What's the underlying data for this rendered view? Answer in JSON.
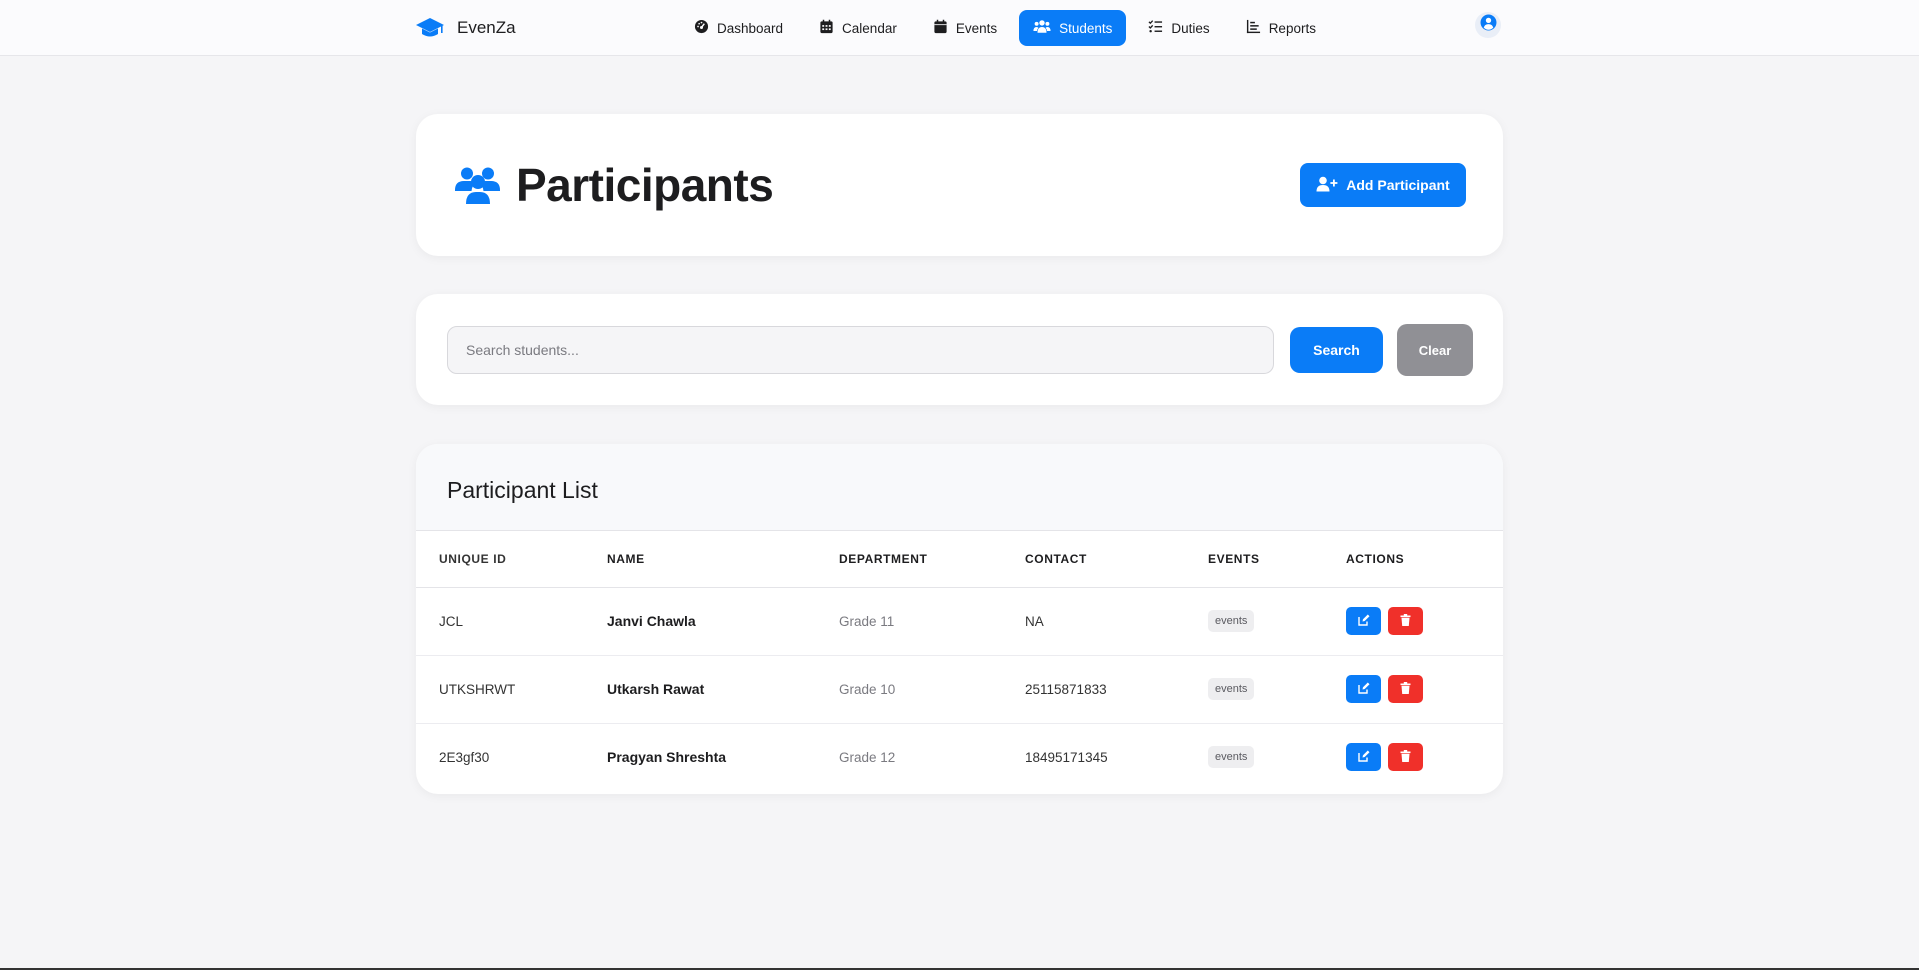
{
  "brand": {
    "name": "EvenZa",
    "icon": "graduation-cap-icon"
  },
  "nav": {
    "items": [
      {
        "label": "Dashboard",
        "icon": "gauge-icon",
        "active": false
      },
      {
        "label": "Calendar",
        "icon": "calendar-icon",
        "active": false
      },
      {
        "label": "Events",
        "icon": "calendar-day-icon",
        "active": false
      },
      {
        "label": "Students",
        "icon": "users-icon",
        "active": true
      },
      {
        "label": "Duties",
        "icon": "list-check-icon",
        "active": false
      },
      {
        "label": "Reports",
        "icon": "bar-chart-icon",
        "active": false
      }
    ],
    "user_icon": "user-circle-icon"
  },
  "header": {
    "title": "Participants",
    "title_icon": "users-icon",
    "add_button": "Add Participant",
    "add_icon": "user-plus-icon"
  },
  "search": {
    "placeholder": "Search students...",
    "value": "",
    "search_button": "Search",
    "clear_button": "Clear"
  },
  "list": {
    "title": "Participant List",
    "columns": [
      "UNIQUE ID",
      "NAME",
      "DEPARTMENT",
      "CONTACT",
      "EVENTS",
      "ACTIONS"
    ],
    "rows": [
      {
        "id": "JCL",
        "name": "Janvi Chawla",
        "department": "Grade 11",
        "contact": "NA",
        "events": "events"
      },
      {
        "id": "UTKSHRWT",
        "name": "Utkarsh Rawat",
        "department": "Grade 10",
        "contact": "25115871833",
        "events": "events"
      },
      {
        "id": "2E3gf30",
        "name": "Pragyan Shreshta",
        "department": "Grade 12",
        "contact": "18495171345",
        "events": "events"
      }
    ]
  },
  "colors": {
    "accent": "#0a7cf7",
    "danger": "#f0302a",
    "muted_button": "#909095",
    "background": "#f5f5f7"
  }
}
